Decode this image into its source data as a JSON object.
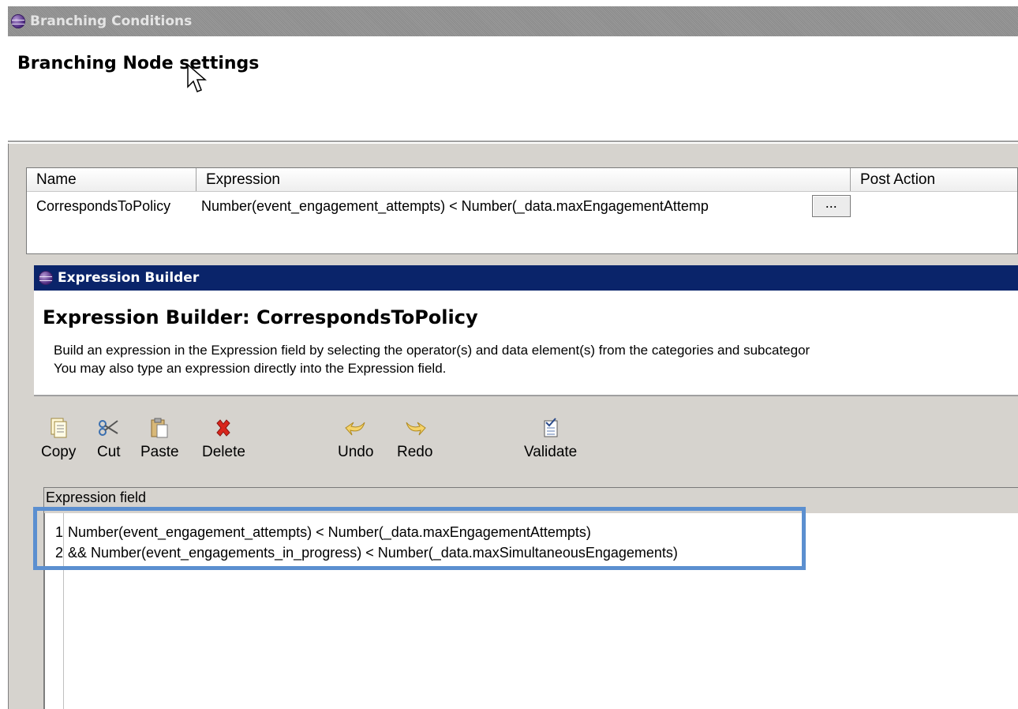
{
  "outer_dialog": {
    "title": "Branching Conditions",
    "heading": "Branching Node settings"
  },
  "table": {
    "columns": [
      "Name",
      "Expression",
      "Post Action"
    ],
    "rows": [
      {
        "name": "CorrespondsToPolicy",
        "expression": "Number(event_engagement_attempts) < Number(_data.maxEngagementAttemp",
        "button": "..."
      }
    ]
  },
  "expression_builder": {
    "title": "Expression Builder",
    "heading": "Expression Builder: CorrespondsToPolicy",
    "description_line1": "Build an expression in the Expression field by selecting the operator(s) and data element(s) from the categories and subcategor",
    "description_line2": "You may also type an expression directly into the Expression field.",
    "toolbar": {
      "copy": "Copy",
      "cut": "Cut",
      "paste": "Paste",
      "delete": "Delete",
      "undo": "Undo",
      "redo": "Redo",
      "validate": "Validate"
    },
    "icons": {
      "copy": "copy-icon",
      "cut": "cut-icon",
      "paste": "paste-icon",
      "delete": "delete-icon",
      "undo": "undo-icon",
      "redo": "redo-icon",
      "validate": "validate-icon"
    },
    "expression_field_label": "Expression field",
    "code_lines": [
      {
        "number": "1",
        "text": "Number(event_engagement_attempts) < Number(_data.maxEngagementAttempts)"
      },
      {
        "number": "2",
        "text": "&& Number(event_engagements_in_progress) < Number(_data.maxSimultaneousEngagements)"
      }
    ]
  },
  "colors": {
    "active_titlebar": "#0a246a",
    "inactive_titlebar": "#8a8a8a",
    "dialog_bg": "#d6d3ce",
    "highlight": "#5b8fd0",
    "delete_red": "#d9261c"
  }
}
